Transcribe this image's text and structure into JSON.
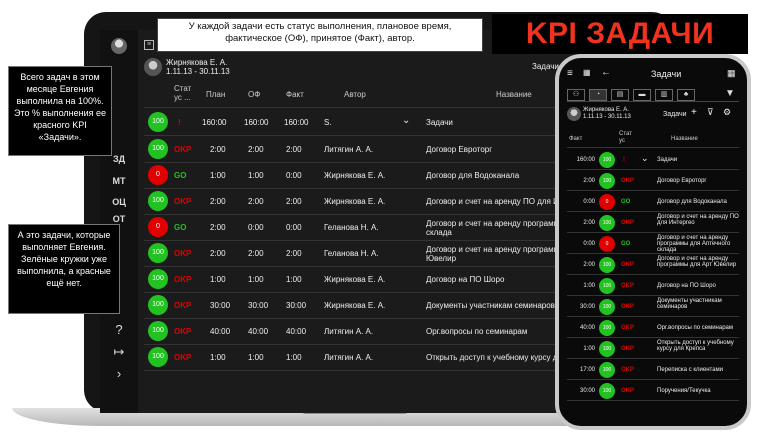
{
  "brand_color": "#f0321e",
  "kpi_badge": "KPI ЗАДАЧИ",
  "callouts": {
    "top": "У каждой задачи есть статус выполнения, плановое время, фактическое (ОФ), принятое (Факт), автор.",
    "left_top": "Всего задач в этом месяце Евгения выполнила на 100%. Это % выполнения ее красного KPI «Задачи».",
    "left_bottom": "А это задачи, которые выполняет Евгения. Зелёные кружки уже выполнила, а красные ещё нет."
  },
  "laptop": {
    "user": {
      "name": "Жирнякова Е. А.",
      "period": "1.11.13 - 30.11.13"
    },
    "title": "Задачи",
    "sidebar": {
      "nav1": "ЗД",
      "nav2": "МТ",
      "nav3": "ОЦ",
      "nav4": "ОТ",
      "help_icon": "?",
      "logout_icon": "↦",
      "expand_icon": "›"
    },
    "columns": {
      "status": "Стат ус ...",
      "plan": "План",
      "of": "ОФ",
      "fact": "Факт",
      "author": "Автор",
      "name": "Название"
    },
    "group_row": {
      "pct": "100",
      "mark": "!",
      "plan": "160:00",
      "of": "160:00",
      "fact": "160:00",
      "author": "S.",
      "name": "Задачи"
    },
    "rows": [
      {
        "pct": "100",
        "label": "OKP",
        "plan": "2:00",
        "of": "2:00",
        "fact": "2:00",
        "author": "Литягин А. А.",
        "name": "Договор Евроторг"
      },
      {
        "pct": "0",
        "label": "GO",
        "plan": "1:00",
        "of": "1:00",
        "fact": "0:00",
        "author": "Жирнякова Е. А.",
        "name": "Договор для Водоканала"
      },
      {
        "pct": "100",
        "label": "OKP",
        "plan": "2:00",
        "of": "2:00",
        "fact": "2:00",
        "author": "Жирнякова Е. А.",
        "name": "Договор и счет на аренду ПО для И"
      },
      {
        "pct": "0",
        "label": "GO",
        "plan": "2:00",
        "of": "0:00",
        "fact": "0:00",
        "author": "Геланова Н. А.",
        "name": "Договор и счет на аренду программ склада"
      },
      {
        "pct": "100",
        "label": "OKP",
        "plan": "2:00",
        "of": "2:00",
        "fact": "2:00",
        "author": "Геланова Н. А.",
        "name": "Договор и счет на аренду программ Ювелир"
      },
      {
        "pct": "100",
        "label": "OKP",
        "plan": "1:00",
        "of": "1:00",
        "fact": "1:00",
        "author": "Жирнякова Е. А.",
        "name": "Договор на ПО Шоро"
      },
      {
        "pct": "100",
        "label": "OKP",
        "plan": "30:00",
        "of": "30:00",
        "fact": "30:00",
        "author": "Жирнякова Е. А.",
        "name": "Документы участникам семинаров"
      },
      {
        "pct": "100",
        "label": "OKP",
        "plan": "40:00",
        "of": "40:00",
        "fact": "40:00",
        "author": "Литягин А. А.",
        "name": "Орг.вопросы по семинарам"
      },
      {
        "pct": "100",
        "label": "OKP",
        "plan": "1:00",
        "of": "1:00",
        "fact": "1:00",
        "author": "Литягин А. А.",
        "name": "Открыть доступ к учебному курсу д"
      }
    ]
  },
  "phone": {
    "title": "Задачи",
    "user": {
      "name": "Жирнякова Е. А.",
      "period": "1.11.13 - 30.11.13"
    },
    "subtitle": "Задачи",
    "columns": {
      "fact": "Факт",
      "status": "Стат ус",
      "name": "Название"
    },
    "group_row": {
      "fact": "160:00",
      "pct": "100",
      "mark": "!",
      "name": "Задачи"
    },
    "rows": [
      {
        "fact": "2:00",
        "pct": "100",
        "label": "OKP",
        "name": "Договор Евроторг"
      },
      {
        "fact": "0:00",
        "pct": "0",
        "label": "GO",
        "name": "Договор для Водоканала"
      },
      {
        "fact": "2:00",
        "pct": "100",
        "label": "OKP",
        "name": "Договор и счет на аренду ПО для Интергео"
      },
      {
        "fact": "0:00",
        "pct": "0",
        "label": "GO",
        "name": "Договор и счет на аренду программы для Аптечного склада"
      },
      {
        "fact": "2:00",
        "pct": "100",
        "label": "OKP",
        "name": "Договор и счет на аренду программы для Арт Ювелир"
      },
      {
        "fact": "1:00",
        "pct": "100",
        "label": "OKP",
        "name": "Договор на ПО Шоро"
      },
      {
        "fact": "30:00",
        "pct": "100",
        "label": "OKP",
        "name": "Документы участникам семинаров"
      },
      {
        "fact": "40:00",
        "pct": "100",
        "label": "OKP",
        "name": "Орг.вопросы по семинарам"
      },
      {
        "fact": "1:00",
        "pct": "100",
        "label": "OKP",
        "name": "Открыть доступ к учебному курсу для Крепса"
      },
      {
        "fact": "17:00",
        "pct": "100",
        "label": "OKP",
        "name": "Переписка с клиентами"
      },
      {
        "fact": "30:00",
        "pct": "100",
        "label": "OKP",
        "name": "Поручения/Текучка"
      }
    ]
  }
}
